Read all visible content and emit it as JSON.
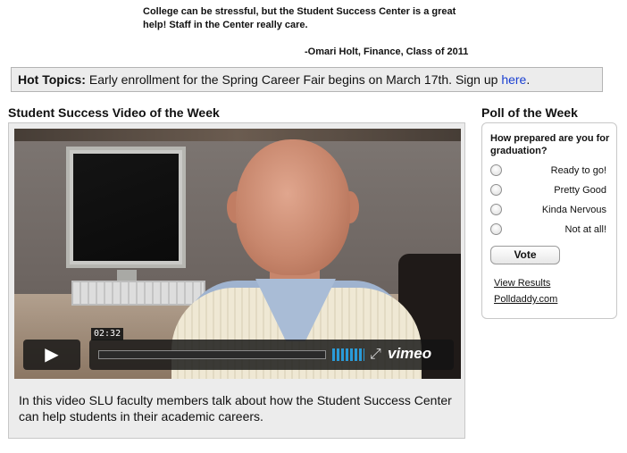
{
  "testimonial": {
    "quote": "College can be stressful, but the Student Success Center is a great help! Staff in the Center really care.",
    "author": "-Omari Holt, Finance, Class of 2011"
  },
  "hot_topics": {
    "label": "Hot Topics:",
    "text": " Early enrollment for the Spring Career Fair begins on March 17th. Sign up ",
    "link": "here",
    "end": "."
  },
  "video": {
    "heading": "Student Success Video of the Week",
    "timecode": "02:32",
    "brand": "vimeo",
    "description": "In this video SLU faculty members talk about how the Student Success Center can help students in their academic careers.",
    "progress_fraction": 0
  },
  "poll": {
    "heading": "Poll of the Week",
    "question": "How prepared are you for graduation?",
    "options": [
      "Ready to go!",
      "Pretty Good",
      "Kinda Nervous",
      "Not at all!"
    ],
    "vote_label": "Vote",
    "view_results": "View Results",
    "provider": "Polldaddy.com"
  },
  "icons": {
    "play": "play-icon",
    "volume": "volume-icon",
    "fullscreen": "fullscreen-icon"
  },
  "colors": {
    "link": "#1a3fd1",
    "volume_bar": "#2a9bd8",
    "panel_bg": "#ececec"
  }
}
